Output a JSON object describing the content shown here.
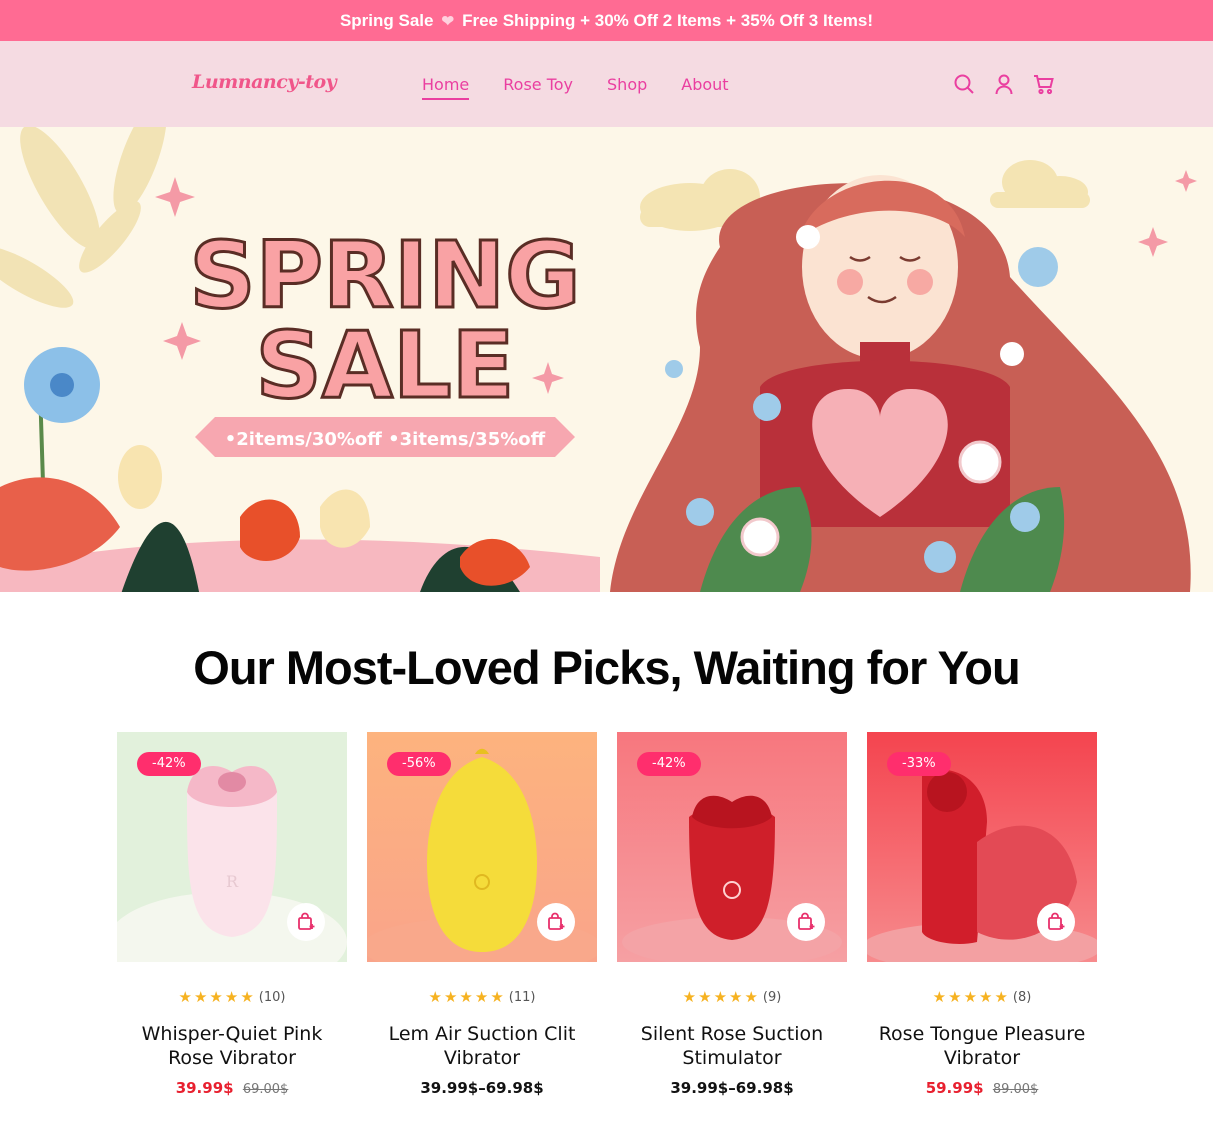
{
  "announcement": {
    "lead": "Spring Sale",
    "icon": "heart-icon",
    "text": "Free Shipping + 30% Off 2 Items + 35% Off 3 Items!"
  },
  "header": {
    "logo": "Lumnancy-toy",
    "nav": [
      "Home",
      "Rose Toy",
      "Shop",
      "About"
    ],
    "active_nav": "Home",
    "icons": [
      "search-icon",
      "account-icon",
      "cart-icon"
    ]
  },
  "hero": {
    "headline_line1": "SPRING",
    "headline_line2": "SALE",
    "ribbon": "•2items/30%off  •3items/35%off"
  },
  "section": {
    "title": "Our Most-Loved Picks, Waiting for You"
  },
  "products": [
    {
      "discount": "-42%",
      "rating_count": "(10)",
      "title": "Whisper-Quiet Pink Rose Vibrator",
      "price_sale": "39.99$",
      "price_old": "69.00$",
      "bg": "#e2f1dc"
    },
    {
      "discount": "-56%",
      "rating_count": "(11)",
      "title": "Lem Air Suction Clit Vibrator",
      "price_range": "39.99$–69.98$",
      "bg": "#fbb083"
    },
    {
      "discount": "-42%",
      "rating_count": "(9)",
      "title": "Silent Rose Suction Stimulator",
      "price_range": "39.99$–69.98$",
      "bg": "#f58a8f"
    },
    {
      "discount": "-33%",
      "rating_count": "(8)",
      "title": "Rose Tongue Pleasure Vibrator",
      "price_sale": "59.99$",
      "price_old": "89.00$",
      "bg": "#f55a62"
    }
  ],
  "colors": {
    "accent": "#ff6b93",
    "nav": "#ea3fa0",
    "header_bg": "#f5dbe2",
    "badge": "#ff2e6d",
    "sale_price": "#e8202f",
    "star": "#f6b221"
  }
}
